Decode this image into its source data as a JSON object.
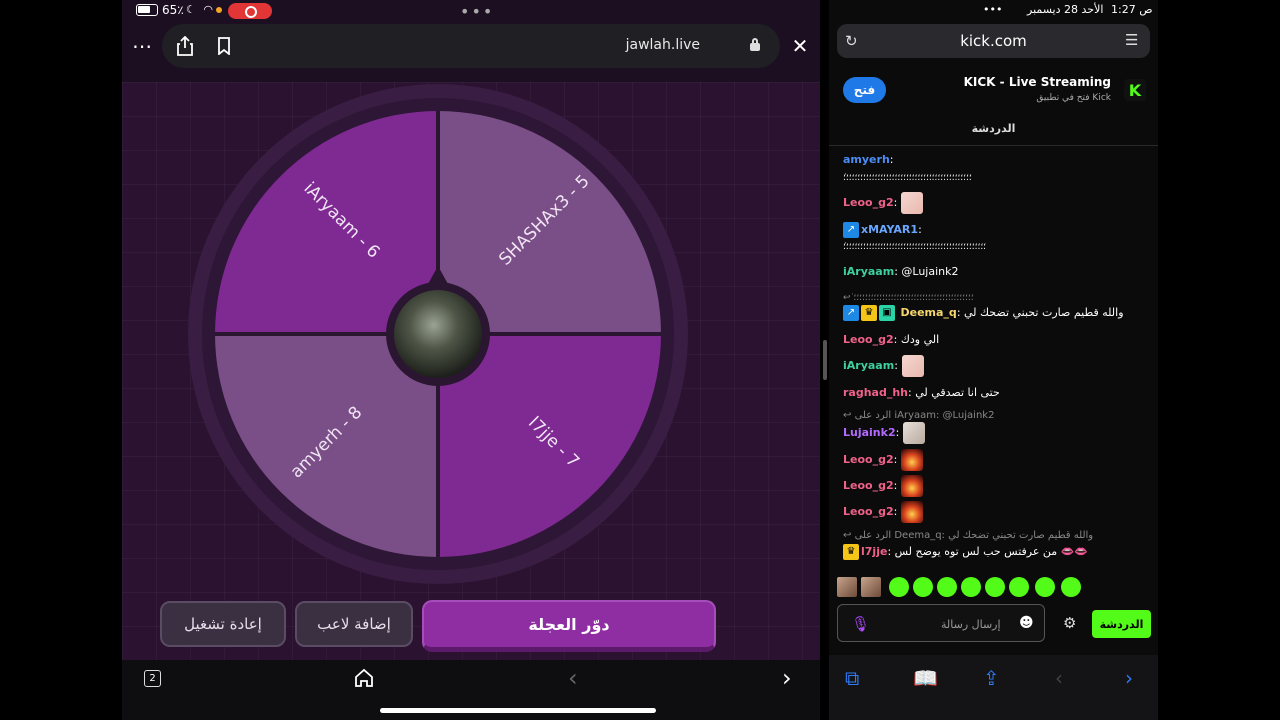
{
  "left_status": {
    "battery": "65٪"
  },
  "left_toolbar": {
    "domain": "jawlah.live"
  },
  "wheel": {
    "segments": [
      {
        "label": "iAryaam - 6",
        "color": "#7e2a92"
      },
      {
        "label": "SHASHAx3 - 5",
        "color": "#7a4e86"
      },
      {
        "label": "l7jje - 7",
        "color": "#7e2a92"
      },
      {
        "label": "amyerh - 8",
        "color": "#7a4e86"
      }
    ]
  },
  "buttons": {
    "restart": "إعادة تشغيل",
    "add_player": "إضافة لاعب",
    "spin": "دوّر العجلة"
  },
  "left_bottom": {
    "tab_count": "2"
  },
  "right_status": {
    "time": "1:27 ص",
    "date": "الأحد 28 ديسمبر"
  },
  "right_toolbar": {
    "url": "kick.com"
  },
  "app_banner": {
    "open_label": "فتح",
    "app_name": "KICK - Live Streaming",
    "subtitle": "فتح في تطبيق Kick",
    "logo_letter": "K"
  },
  "chat": {
    "title": "الدردشة",
    "messages": [
      {
        "user": "amyerh",
        "text": "",
        "color": "#4b8cf5"
      },
      {
        "user": "",
        "text": "ٰ؛؛؛؛؛؛؛؛؛؛؛؛؛؛؛؛؛؛؛؛؛؛؛؛؛؛؛؛؛؛؛؛؛؛؛؛؛؛؛؛؛؛؛؛؛",
        "color": "#fff"
      },
      {
        "user": "Leoo_g2",
        "text": "",
        "color": "#f0628a"
      },
      {
        "user": "xMAYAR1",
        "text": "",
        "color": "#6aa7ff"
      },
      {
        "user": "",
        "text": "ٰ؛؛؛؛؛؛؛؛؛؛؛؛؛؛؛؛؛؛؛؛؛؛؛؛؛؛؛؛؛؛؛؛؛؛؛؛؛؛؛؛؛؛؛؛؛؛؛؛؛؛",
        "color": "#fff"
      },
      {
        "user": "iAryaam",
        "text": "@Lujaink2",
        "color": "#3fd0a0"
      },
      {
        "user": "",
        "text": "ٰ؛؛؛؛؛؛؛؛؛؛؛؛؛؛؛؛؛؛؛؛؛؛؛؛؛؛؛؛؛؛؛؛؛؛؛؛؛؛؛؛؛؛",
        "color": "#888"
      },
      {
        "user": "Deema_q",
        "text": "والله قطيم صارت تحبني تضحك لي",
        "color": "#f5d76e"
      },
      {
        "user": "Leoo_g2",
        "text": "الي ودك",
        "color": "#f0628a"
      },
      {
        "user": "iAryaam",
        "text": "",
        "color": "#3fd0a0"
      },
      {
        "user": "raghad_hh",
        "text": "حتى انا تصدقي لي",
        "color": "#f0628a"
      },
      {
        "user": "",
        "text": "الرد على iAryaam: @Lujaink2",
        "color": "#888"
      },
      {
        "user": "Lujaink2",
        "text": "",
        "color": "#b36bff"
      },
      {
        "user": "Leoo_g2",
        "text": "",
        "color": "#f0628a"
      },
      {
        "user": "Leoo_g2",
        "text": "",
        "color": "#f0628a"
      },
      {
        "user": "Leoo_g2",
        "text": "",
        "color": "#f0628a"
      },
      {
        "user": "",
        "text": "الرد على Deema_q: والله قطيم صارت تحبني تضحك لي",
        "color": "#888"
      },
      {
        "user": "l7jje",
        "text": "من عرفتس حب لس توه يوضح لس 👄👄",
        "color": "#f0628a"
      }
    ],
    "input_placeholder": "إرسال رسالة",
    "send_label": "الدردشة"
  },
  "accent_colors": {
    "kick_green": "#53fc18",
    "primary_purple": "#8f2ea3",
    "ios_blue": "#2f7bf5"
  }
}
